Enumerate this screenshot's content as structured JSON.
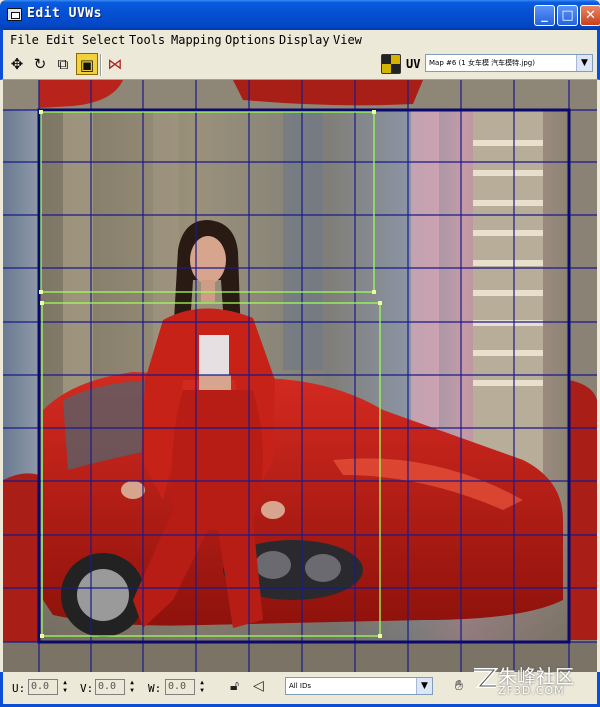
{
  "window": {
    "title": "Edit UVWs",
    "minimize": "_",
    "maximize": "□",
    "close": "✕"
  },
  "menu": [
    "File",
    "Edit",
    "Select",
    "Tools",
    "Mapping",
    "Options",
    "Display",
    "View"
  ],
  "toolbar": {
    "tools": [
      {
        "name": "move-icon",
        "glyph": "✥",
        "active": false
      },
      {
        "name": "rotate-icon",
        "glyph": "↻",
        "active": false
      },
      {
        "name": "scale-icon",
        "glyph": "⧉",
        "active": false
      },
      {
        "name": "freeform-icon",
        "glyph": "▣",
        "active": true
      },
      {
        "name": "mirror-icon",
        "glyph": "⋈",
        "active": false
      }
    ],
    "uv_label": "UV",
    "map_selector": "Map #6 (1 女车模 汽车模特.jpg)"
  },
  "status": {
    "u_label": "U:",
    "u_value": "0.0",
    "v_label": "V:",
    "v_value": "0.0",
    "w_label": "W:",
    "w_value": "0.0",
    "ids_selector": "All IDs"
  },
  "watermark": {
    "text": "朱峰社区",
    "sub": "ZF3D.COM"
  },
  "colors": {
    "grid": "#1a1a8c",
    "uv_shell": "#9cff5a",
    "title_bar": "#0551d4"
  }
}
